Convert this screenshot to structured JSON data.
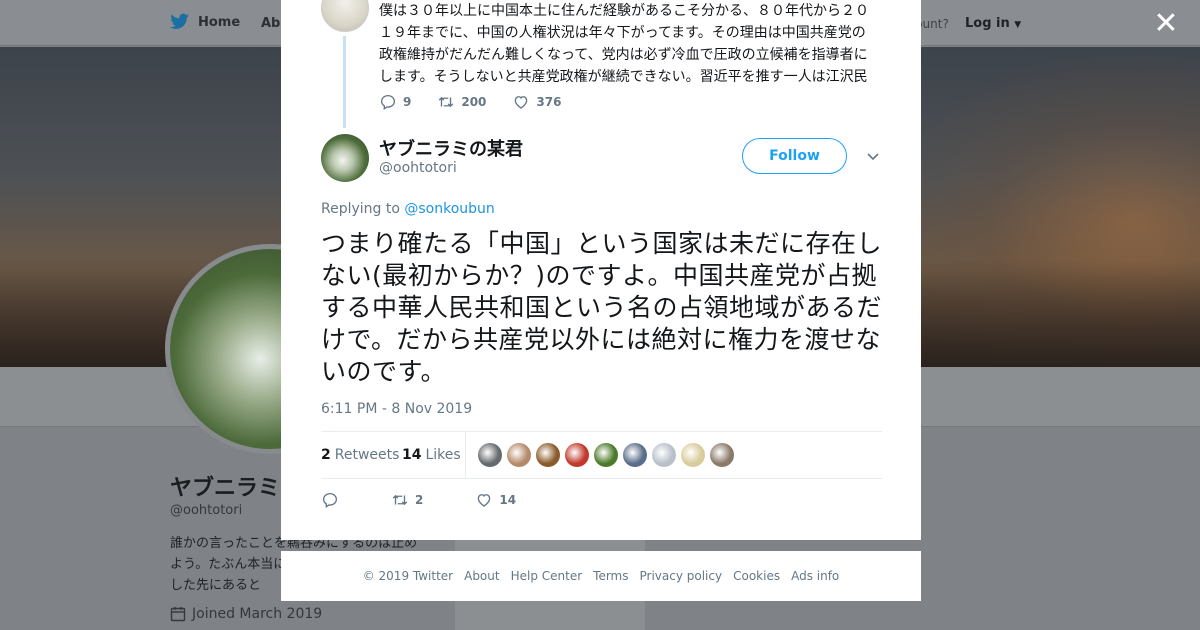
{
  "nav": {
    "home": "Home",
    "about": "Abo",
    "account_prompt": "ccount?",
    "login": "Log in"
  },
  "profile": {
    "name": "ヤブニラミ",
    "handle": "@oohtotori",
    "bio": "誰かの言ったことを鵜呑みにするのは止めよう。たぶん本当に正しいことは自分で検証した先にあると",
    "joined": "Joined March 2019"
  },
  "parent_tweet": {
    "text": "僕は３０年以上に中国本土に住んだ経験があるこそ分かる、８０年代から２０１９年までに、中国の人権状況は年々下がってます。その理由は中国共産党の政権維持がだんだん難しくなって、党内は必ず冷血で圧政の立候補を指導者にします。そうしないと共産党政権が継続できない。習近平を推す一人は江沢民",
    "replies": "9",
    "retweets": "200",
    "likes": "376"
  },
  "tweet": {
    "name": "ヤブニラミの某君",
    "handle": "@oohtotori",
    "follow_label": "Follow",
    "replying_prefix": "Replying to",
    "replying_to": "@sonkoubun",
    "text": "つまり確たる「中国」という国家は未だに存在しない(最初からか？)のですよ。中国共産党が占拠する中華人民共和国という名の占領地域があるだけで。だから共産党以外には絶対に権力を渡せないのです。",
    "timestamp": "6:11 PM - 8 Nov 2019",
    "retweet_count": "2",
    "retweet_label": "Retweets",
    "like_count": "14",
    "like_label": "Likes",
    "action_retweets": "2",
    "action_likes": "14"
  },
  "liker_colors": [
    "#666a6e",
    "#b58a6a",
    "#8a5a2a",
    "#c0392b",
    "#4d7a2a",
    "#5a6d8a",
    "#b8c0ca",
    "#d8cc9a",
    "#8a7a6a"
  ],
  "footer": [
    "© 2019 Twitter",
    "About",
    "Help Center",
    "Terms",
    "Privacy policy",
    "Cookies",
    "Ads info"
  ],
  "colors": {
    "accent": "#1da1f2",
    "link": "#1b95e0",
    "muted": "#657786"
  }
}
